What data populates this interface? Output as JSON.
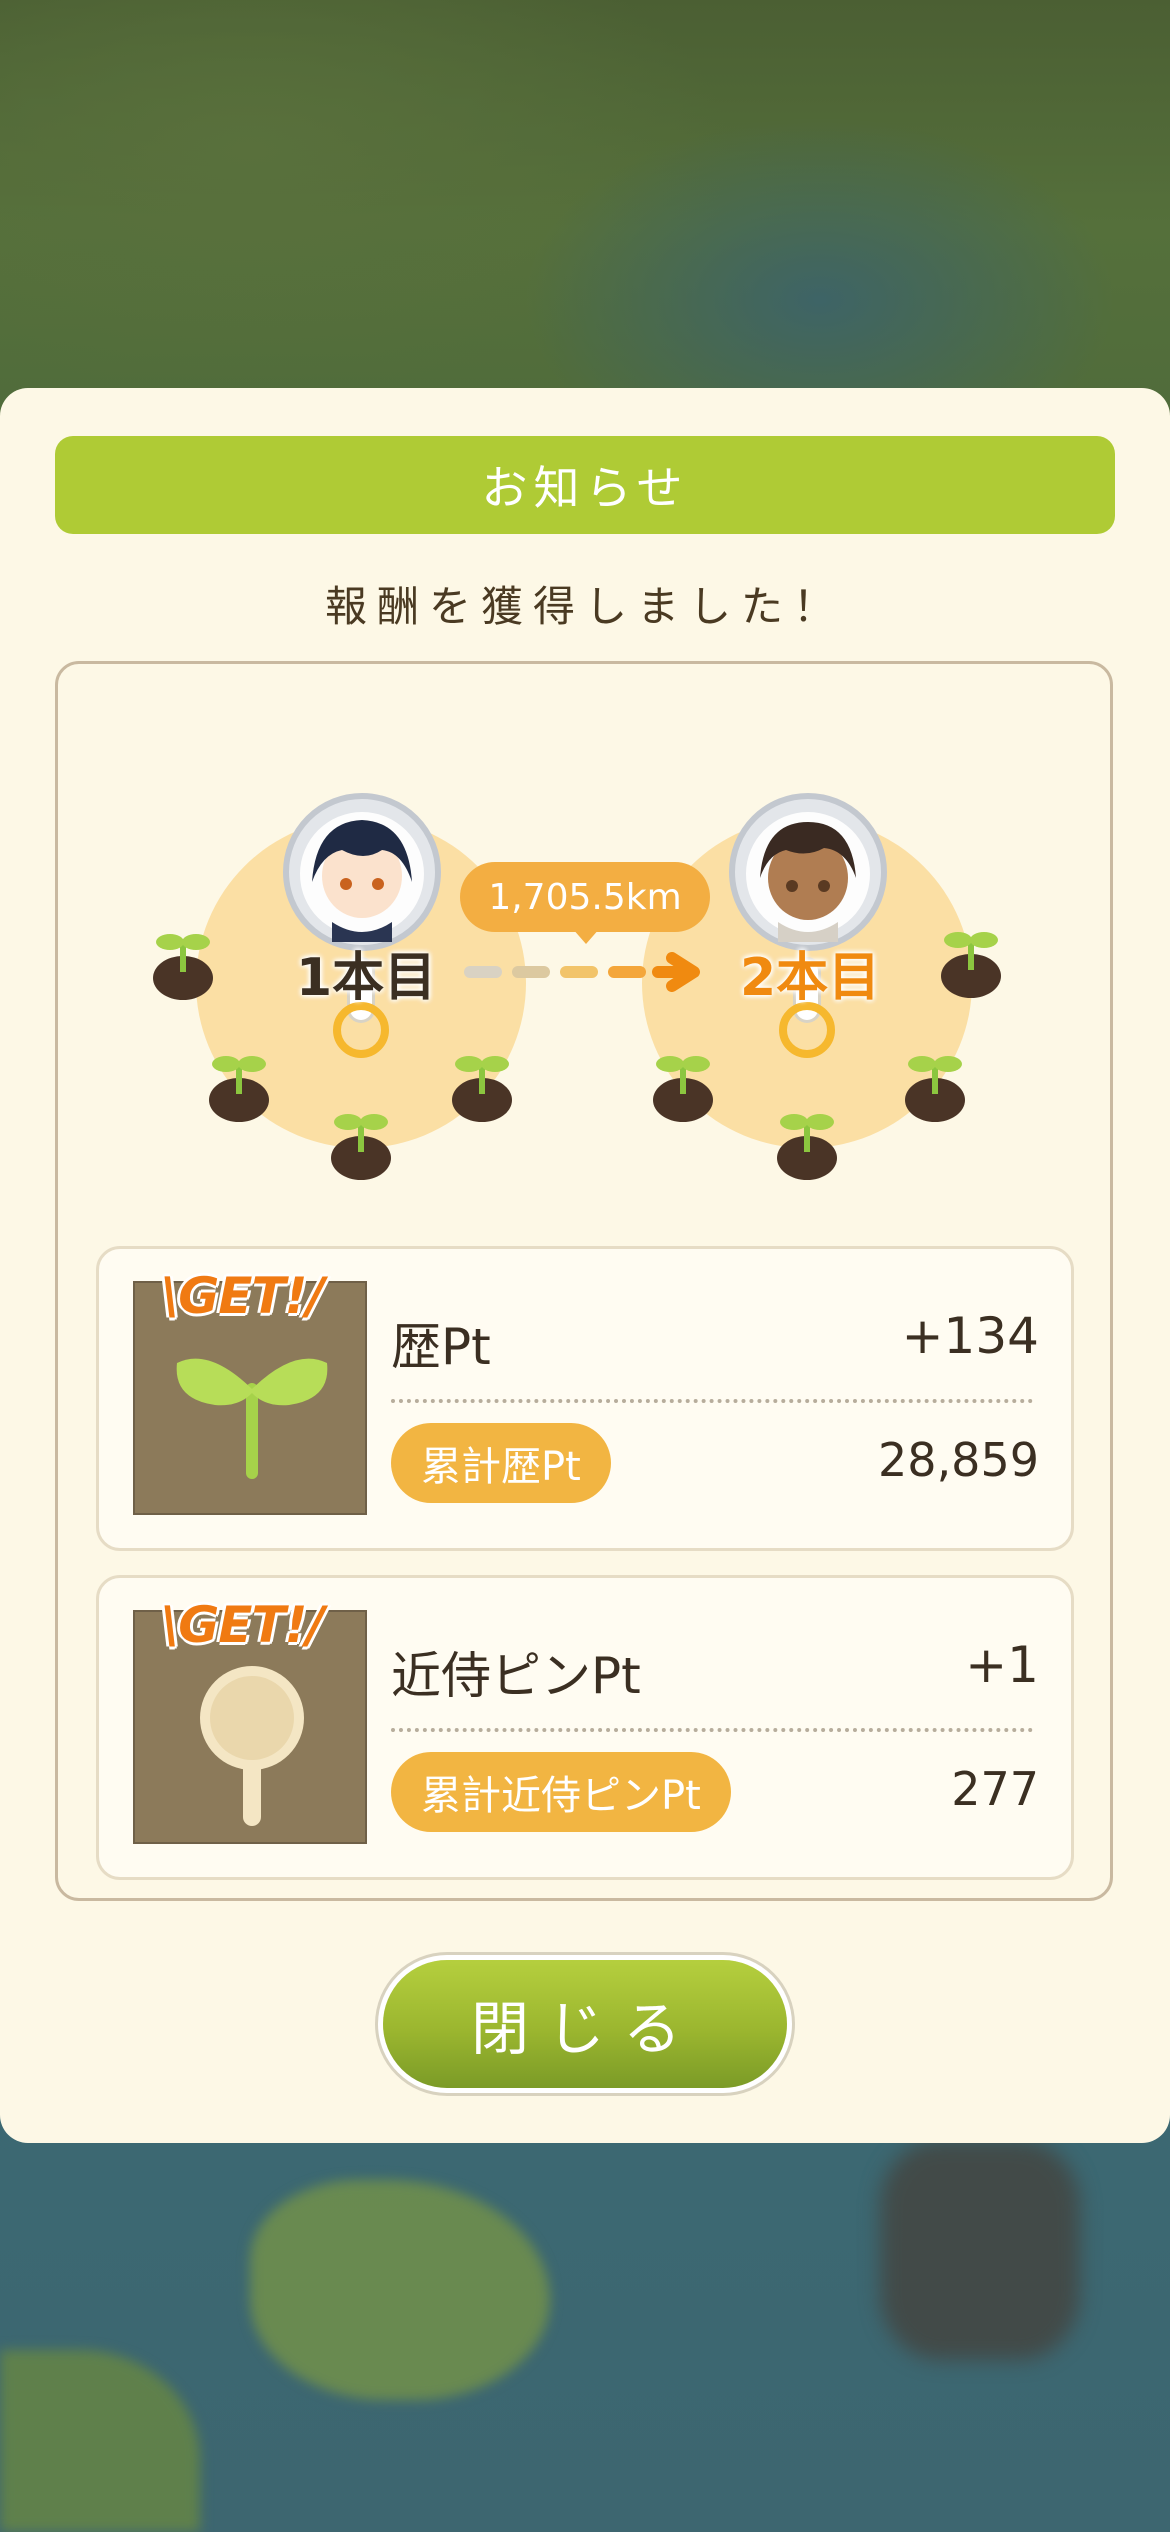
{
  "dialog": {
    "title": "お知らせ",
    "subtitle": "報酬を獲得しました！",
    "distance": "1,705.5km",
    "pins": {
      "first_label": "1本目",
      "second_label": "2本目"
    },
    "rewards": [
      {
        "badge": "\\GET!/",
        "icon": "sprout-icon",
        "label": "歴Pt",
        "value": "+134",
        "total_label": "累計歴Pt",
        "total_value": "28,859"
      },
      {
        "badge": "\\GET!/",
        "icon": "pin-icon",
        "label": "近侍ピンPt",
        "value": "+1",
        "total_label": "累計近侍ピンPt",
        "total_value": "277"
      }
    ],
    "close_button": "閉じる"
  },
  "colors": {
    "title_bar": "#afcb35",
    "panel": "#fdf8e6",
    "pill": "#f2b542",
    "accent_orange": "#f08a10",
    "text": "#3b2f22"
  }
}
